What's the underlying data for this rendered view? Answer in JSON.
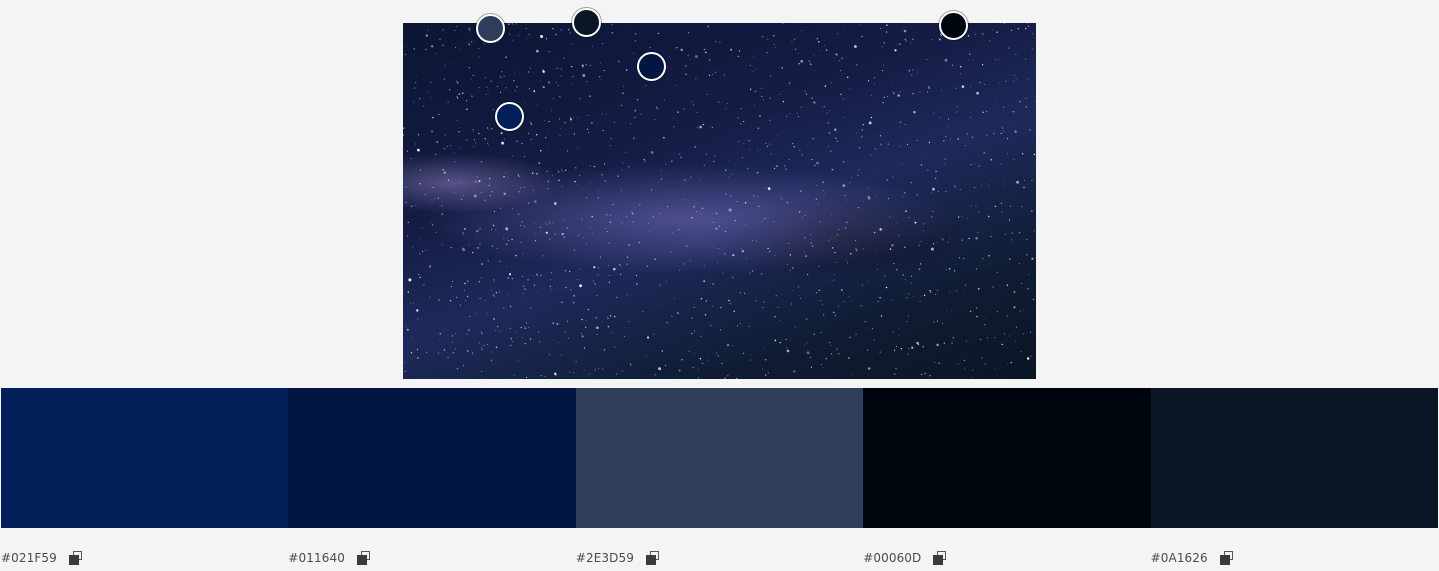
{
  "image": {
    "alt_icon": "milky-way-photo"
  },
  "pickers": [
    {
      "color": "#2E3D59"
    },
    {
      "color": "#0A1626"
    },
    {
      "color": "#011640"
    },
    {
      "color": "#021F59"
    },
    {
      "color": "#00060D"
    }
  ],
  "swatches": [
    {
      "hex": "#021F59",
      "color": "#021F59"
    },
    {
      "hex": "#011640",
      "color": "#011640"
    },
    {
      "hex": "#2E3D59",
      "color": "#2E3D59"
    },
    {
      "hex": "#00060D",
      "color": "#00060D"
    },
    {
      "hex": "#0A1626",
      "color": "#0A1626"
    }
  ],
  "icons": {
    "copy": "copy-icon"
  }
}
